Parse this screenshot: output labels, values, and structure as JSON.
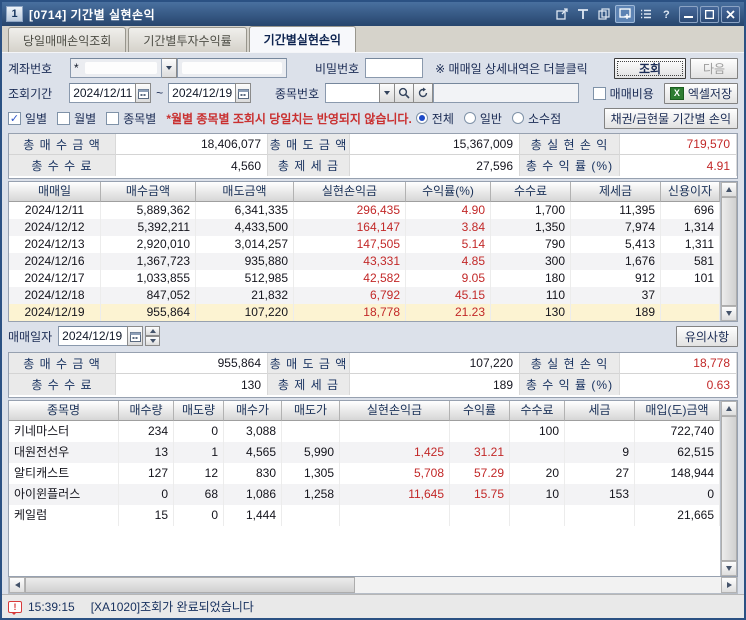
{
  "colors": {
    "red": "#c22828",
    "selected_row": "#fcf3d2",
    "titlebar_top": "#49709f",
    "titlebar_bottom": "#27456d"
  },
  "titlebar": {
    "badge": "1",
    "title": "[0714] 기간별 실현손익",
    "tools": [
      "popout-icon",
      "text-icon",
      "copy-icon",
      "multiwindow-icon",
      "list-icon",
      "help-icon"
    ],
    "active_tool_index": 3
  },
  "tabs": {
    "items": [
      "당일매매손익조회",
      "기간별투자수익률",
      "기간별실현손익"
    ],
    "active": 2
  },
  "filter": {
    "account_label": "계좌번호",
    "account_value": "*",
    "password_label": "비밀번호",
    "password_value": "",
    "note": "※ 매매일 상세내역은 더블클릭",
    "query_button": "조회",
    "next_button": "다음",
    "period_label": "조회기간",
    "date_from": "2024/12/11",
    "date_separator": "~",
    "date_to": "2024/12/19",
    "stock_label": "종목번호",
    "stock_code": "",
    "stock_name": "",
    "fee_label": "매매비용",
    "excel_button": "엑셀저장",
    "view_checks": [
      {
        "label": "일별",
        "checked": true
      },
      {
        "label": "월별",
        "checked": false
      },
      {
        "label": "종목별",
        "checked": false
      }
    ],
    "warning": "*월별 종목별 조회시 당일치는 반영되지 않습니다.",
    "scope_radios": [
      {
        "label": "전체",
        "selected": true
      },
      {
        "label": "일반",
        "selected": false
      },
      {
        "label": "소수점",
        "selected": false
      }
    ],
    "bond_button": "채권/금현물 기간별 손익"
  },
  "summary_top": {
    "cells": [
      {
        "label": "총 매 수 금 액",
        "value": "18,406,077",
        "red": false
      },
      {
        "label": "총 매 도 금 액",
        "value": "15,367,009",
        "red": false
      },
      {
        "label": "총 실 현 손 익",
        "value": "719,570",
        "red": true
      },
      {
        "label": "총 수 수 료",
        "value": "4,560",
        "red": false
      },
      {
        "label": "총 제 세 금",
        "value": "27,596",
        "red": false
      },
      {
        "label": "총 수 익 률 (%)",
        "value": "4.91",
        "red": true
      }
    ]
  },
  "daily_table": {
    "columns": [
      "매매일",
      "매수금액",
      "매도금액",
      "실현손익금",
      "수익률(%)",
      "수수료",
      "제세금",
      "신용이자"
    ],
    "red_columns": [
      3,
      4
    ],
    "selected_row": 6,
    "rows": [
      [
        "2024/12/11",
        "5,889,362",
        "6,341,335",
        "296,435",
        "4.90",
        "1,700",
        "11,395",
        "696"
      ],
      [
        "2024/12/12",
        "5,392,211",
        "4,433,500",
        "164,147",
        "3.84",
        "1,350",
        "7,974",
        "1,314"
      ],
      [
        "2024/12/13",
        "2,920,010",
        "3,014,257",
        "147,505",
        "5.14",
        "790",
        "5,413",
        "1,311"
      ],
      [
        "2024/12/16",
        "1,367,723",
        "935,880",
        "43,331",
        "4.85",
        "300",
        "1,676",
        "581"
      ],
      [
        "2024/12/17",
        "1,033,855",
        "512,985",
        "42,582",
        "9.05",
        "180",
        "912",
        "101"
      ],
      [
        "2024/12/18",
        "847,052",
        "21,832",
        "6,792",
        "45.15",
        "110",
        "37",
        ""
      ],
      [
        "2024/12/19",
        "955,864",
        "107,220",
        "18,778",
        "21.23",
        "130",
        "189",
        ""
      ]
    ]
  },
  "trade_date": {
    "label": "매매일자",
    "value": "2024/12/19",
    "notice_button": "유의사항"
  },
  "summary_detail": {
    "cells": [
      {
        "label": "총 매 수 금 액",
        "value": "955,864",
        "red": false
      },
      {
        "label": "총 매 도 금 액",
        "value": "107,220",
        "red": false
      },
      {
        "label": "총 실 현 손 익",
        "value": "18,778",
        "red": true
      },
      {
        "label": "총 수 수 료",
        "value": "130",
        "red": false
      },
      {
        "label": "총 제 세 금",
        "value": "189",
        "red": false
      },
      {
        "label": "총 수 익 률 (%)",
        "value": "0.63",
        "red": true
      }
    ]
  },
  "stock_table": {
    "columns": [
      "종목명",
      "매수량",
      "매도량",
      "매수가",
      "매도가",
      "실현손익금",
      "수익률",
      "수수료",
      "세금",
      "매입(도)금액"
    ],
    "red_columns": [
      5,
      6
    ],
    "rows": [
      [
        "키네마스터",
        "234",
        "0",
        "3,088",
        "",
        "",
        "",
        "100",
        "",
        "722,740"
      ],
      [
        "대원전선우",
        "13",
        "1",
        "4,565",
        "5,990",
        "1,425",
        "31.21",
        "",
        "9",
        "62,515"
      ],
      [
        "알티캐스트",
        "127",
        "12",
        "830",
        "1,305",
        "5,708",
        "57.29",
        "20",
        "27",
        "148,944"
      ],
      [
        "아이윈플러스",
        "0",
        "68",
        "1,086",
        "1,258",
        "11,645",
        "15.75",
        "10",
        "153",
        "0"
      ],
      [
        "케일럼",
        "15",
        "0",
        "1,444",
        "",
        "",
        "",
        "",
        "",
        "21,665"
      ]
    ]
  },
  "status_bar": {
    "time": "15:39:15",
    "message": "[XA1020]조회가 완료되었습니다"
  }
}
